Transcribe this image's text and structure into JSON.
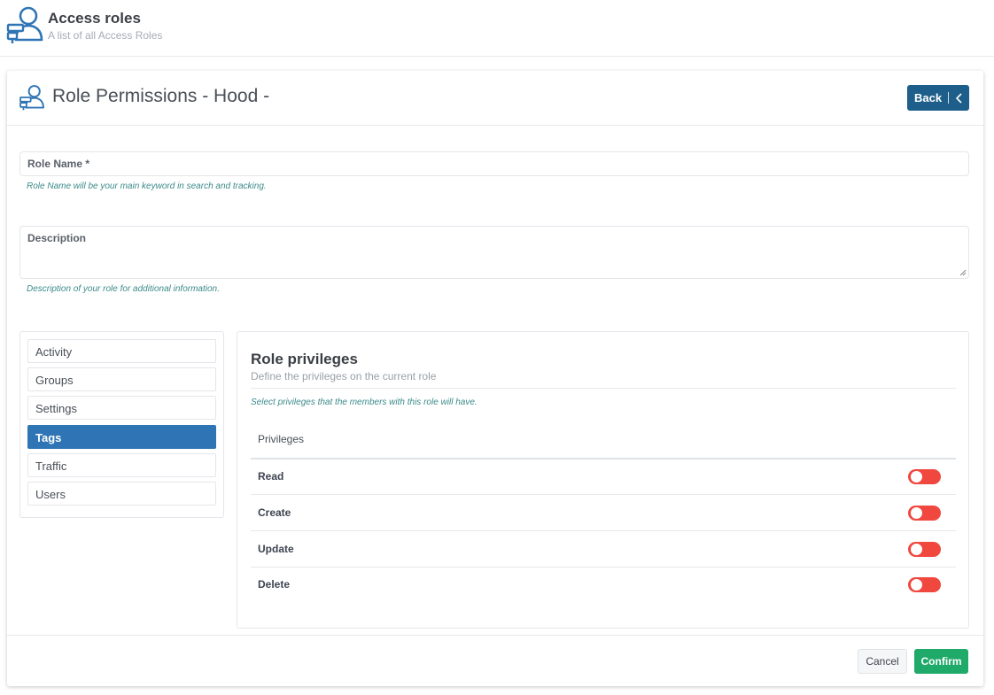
{
  "page_header": {
    "title": "Access roles",
    "subtitle": "A list of all Access Roles",
    "icon": "user-roles-icon"
  },
  "card": {
    "title": "Role Permissions - Hood -",
    "icon": "user-roles-icon",
    "back_label": "Back"
  },
  "form": {
    "role_name": {
      "label": "Role Name *",
      "value": "",
      "hint": "Role Name will be your main keyword in search and tracking."
    },
    "description": {
      "label": "Description",
      "value": "",
      "hint": "Description of your role for additional information."
    }
  },
  "sidebar": {
    "items": [
      {
        "label": "Activity",
        "active": false
      },
      {
        "label": "Groups",
        "active": false
      },
      {
        "label": "Settings",
        "active": false
      },
      {
        "label": "Tags",
        "active": true
      },
      {
        "label": "Traffic",
        "active": false
      },
      {
        "label": "Users",
        "active": false
      }
    ]
  },
  "privileges": {
    "title": "Role privileges",
    "subtitle": "Define the privileges on the current role",
    "hint": "Select privileges that the members with this role will have.",
    "column_header": "Privileges",
    "rows": [
      {
        "label": "Read",
        "enabled": false
      },
      {
        "label": "Create",
        "enabled": false
      },
      {
        "label": "Update",
        "enabled": false
      },
      {
        "label": "Delete",
        "enabled": false
      }
    ]
  },
  "footer": {
    "cancel_label": "Cancel",
    "confirm_label": "Confirm"
  },
  "colors": {
    "primary": "#1d5f8a",
    "active_tab": "#2f75b5",
    "confirm": "#1faa6a",
    "toggle_off": "#f0473e",
    "hint": "#3c8a8a"
  }
}
